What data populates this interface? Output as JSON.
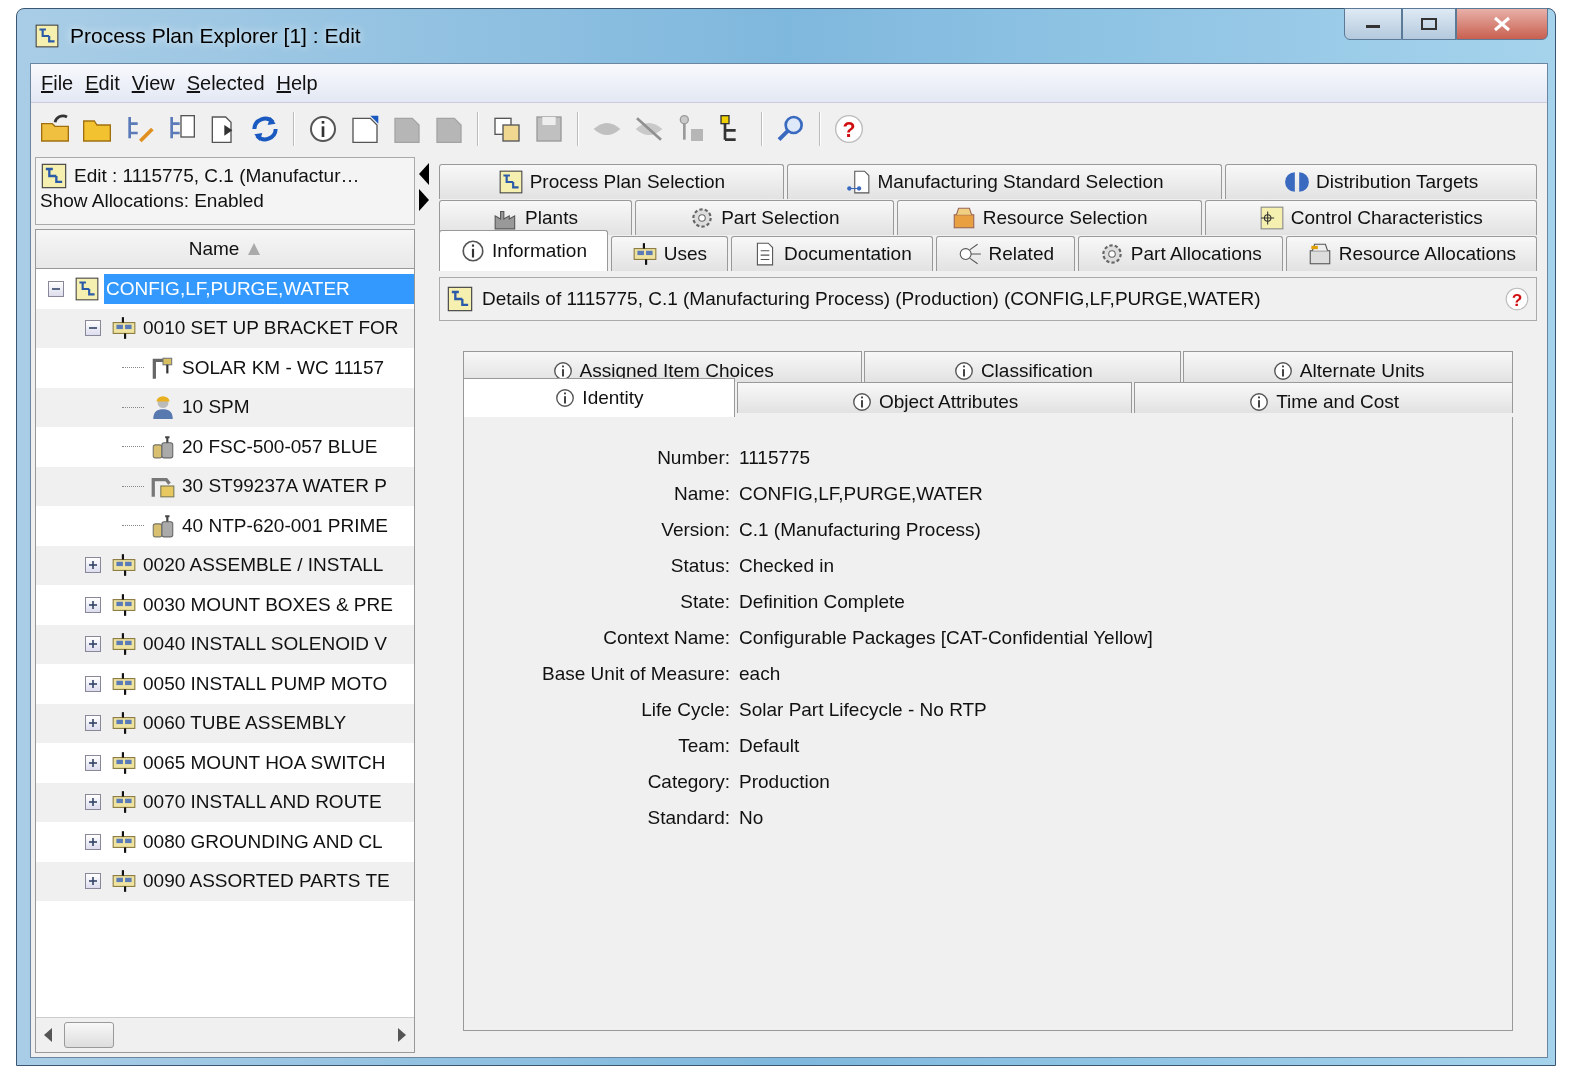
{
  "window": {
    "title": "Process Plan Explorer [1] : Edit"
  },
  "menu": [
    {
      "label": "File"
    },
    {
      "label": "Edit"
    },
    {
      "label": "View"
    },
    {
      "label": "Selected"
    },
    {
      "label": "Help"
    }
  ],
  "toolbar": [
    {
      "kind": "open",
      "disabled": false
    },
    {
      "kind": "folder",
      "disabled": false
    },
    {
      "kind": "edit-tree",
      "disabled": false
    },
    {
      "kind": "tree-list",
      "disabled": false
    },
    {
      "kind": "export",
      "disabled": false
    },
    {
      "kind": "refresh",
      "disabled": false
    },
    {
      "kind": "separator"
    },
    {
      "kind": "info",
      "disabled": false
    },
    {
      "kind": "new-page",
      "disabled": false
    },
    {
      "kind": "page",
      "disabled": true
    },
    {
      "kind": "page",
      "disabled": true
    },
    {
      "kind": "separator"
    },
    {
      "kind": "ab",
      "disabled": false
    },
    {
      "kind": "save",
      "disabled": true
    },
    {
      "kind": "separator"
    },
    {
      "kind": "eye",
      "disabled": true
    },
    {
      "kind": "eye-off",
      "disabled": true
    },
    {
      "kind": "nodes",
      "disabled": true
    },
    {
      "kind": "tree",
      "disabled": false
    },
    {
      "kind": "separator"
    },
    {
      "kind": "search",
      "disabled": false
    },
    {
      "kind": "separator"
    },
    {
      "kind": "help",
      "disabled": false,
      "glyph": "?"
    }
  ],
  "left_pane": {
    "context": "Edit : 1115775, C.1 (Manufactur…",
    "allocations": "Show Allocations: Enabled",
    "column": "Name"
  },
  "tree": [
    {
      "label": "CONFIG,LF,PURGE,WATER",
      "kind": "plan",
      "selected": true,
      "expanded": true,
      "children": [
        {
          "label": "0010 SET UP BRACKET FOR",
          "kind": "operation",
          "selected": false,
          "expanded": true,
          "children": [
            {
              "label": "SOLAR KM - WC 11157",
              "kind": "workcenter",
              "selected": false
            },
            {
              "label": "10 SPM",
              "kind": "person",
              "selected": false
            },
            {
              "label": "20 FSC-500-057 BLUE",
              "kind": "part",
              "selected": false
            },
            {
              "label": "30 ST99237A WATER P",
              "kind": "machine",
              "selected": false
            },
            {
              "label": "40 NTP-620-001 PRIME",
              "kind": "part",
              "selected": false
            }
          ]
        },
        {
          "label": "0020 ASSEMBLE / INSTALL",
          "kind": "operation",
          "selected": false,
          "expanded": false
        },
        {
          "label": "0030 MOUNT BOXES & PRE",
          "kind": "operation",
          "selected": false,
          "expanded": false
        },
        {
          "label": "0040 INSTALL SOLENOID V",
          "kind": "operation",
          "selected": false,
          "expanded": false
        },
        {
          "label": "0050 INSTALL PUMP MOTO",
          "kind": "operation",
          "selected": false,
          "expanded": false
        },
        {
          "label": "0060 TUBE ASSEMBLY",
          "kind": "operation",
          "selected": false,
          "expanded": false
        },
        {
          "label": "0065 MOUNT HOA SWITCH",
          "kind": "operation",
          "selected": false,
          "expanded": false
        },
        {
          "label": "0070 INSTALL AND ROUTE",
          "kind": "operation",
          "selected": false,
          "expanded": false
        },
        {
          "label": "0080 GROUNDING AND CL",
          "kind": "operation",
          "selected": false,
          "expanded": false
        },
        {
          "label": "0090 ASSORTED PARTS TE",
          "kind": "operation",
          "selected": false,
          "expanded": false
        }
      ]
    }
  ],
  "tab_rows": [
    {
      "tabs": [
        {
          "label": "Process Plan Selection",
          "kind": "plan",
          "selected": false
        },
        {
          "label": "Manufacturing Standard Selection",
          "kind": "standard",
          "selected": false
        },
        {
          "label": "Distribution Targets",
          "kind": "targets",
          "selected": false
        }
      ]
    },
    {
      "tabs": [
        {
          "label": "Plants",
          "kind": "plants",
          "selected": false
        },
        {
          "label": "Part Selection",
          "kind": "gear",
          "selected": false
        },
        {
          "label": "Resource Selection",
          "kind": "resource",
          "selected": false
        },
        {
          "label": "Control Characteristics",
          "kind": "control",
          "selected": false
        }
      ]
    },
    {
      "tabs": [
        {
          "label": "Information",
          "kind": "info",
          "selected": true
        },
        {
          "label": "Uses",
          "kind": "operation",
          "selected": false
        },
        {
          "label": "Documentation",
          "kind": "document",
          "selected": false
        },
        {
          "label": "Related",
          "kind": "related",
          "selected": false
        },
        {
          "label": "Part Allocations",
          "kind": "gear",
          "selected": false
        },
        {
          "label": "Resource Allocations",
          "kind": "resource-alloc",
          "selected": false
        }
      ]
    }
  ],
  "details": {
    "title": "Details of 1115775, C.1 (Manufacturing Process) (Production) (CONFIG,LF,PURGE,WATER)",
    "help": "?"
  },
  "subtab_rows": [
    {
      "tabs": [
        {
          "label": "Assigned Item Choices",
          "selected": false
        },
        {
          "label": "Classification",
          "selected": false
        },
        {
          "label": "Alternate Units",
          "selected": false
        }
      ]
    },
    {
      "tabs": [
        {
          "label": "Identity",
          "selected": true
        },
        {
          "label": "Object Attributes",
          "selected": false
        },
        {
          "label": "Time and Cost",
          "selected": false
        }
      ]
    }
  ],
  "properties": [
    {
      "label": "Number:",
      "value": "1115775"
    },
    {
      "label": "Name:",
      "value": "CONFIG,LF,PURGE,WATER"
    },
    {
      "label": "Version:",
      "value": "C.1 (Manufacturing Process)"
    },
    {
      "label": "Status:",
      "value": "Checked in"
    },
    {
      "label": "State:",
      "value": "Definition Complete"
    },
    {
      "label": "Context Name:",
      "value": "Configurable Packages [CAT-Confidential Yellow]"
    },
    {
      "label": "Base Unit of Measure:",
      "value": "each"
    },
    {
      "label": "Life Cycle:",
      "value": "Solar Part Lifecycle - No RTP"
    },
    {
      "label": "Team:",
      "value": "Default"
    },
    {
      "label": "Category:",
      "value": "Production"
    },
    {
      "label": "Standard:",
      "value": "No"
    }
  ]
}
